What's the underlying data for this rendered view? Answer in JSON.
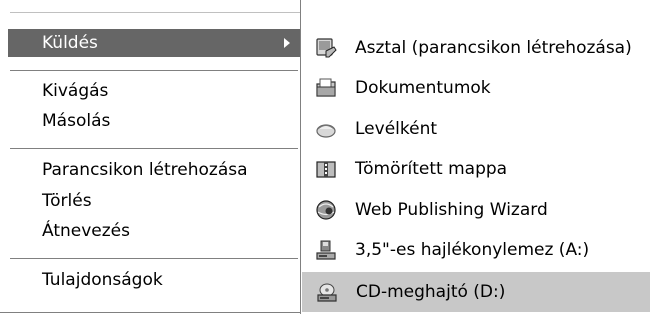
{
  "context_menu": {
    "items": [
      {
        "label": "Küldés",
        "highlighted": true,
        "has_submenu": true
      },
      {
        "label": "Kivágás"
      },
      {
        "label": "Másolás"
      },
      {
        "label": "Parancsikon létrehozása"
      },
      {
        "label": "Törlés"
      },
      {
        "label": "Átnevezés"
      },
      {
        "label": "Tulajdonságok"
      }
    ]
  },
  "send_to_submenu": {
    "items": [
      {
        "label": "Asztal (parancsikon létrehozása)",
        "icon": "desktop-icon"
      },
      {
        "label": "Dokumentumok",
        "icon": "documents-folder-icon"
      },
      {
        "label": "Levélként",
        "icon": "mail-icon"
      },
      {
        "label": "Tömörített mappa",
        "icon": "zip-folder-icon"
      },
      {
        "label": "Web Publishing Wizard",
        "icon": "web-publishing-icon"
      },
      {
        "label": "3,5\"-es hajlékonylemez (A:)",
        "icon": "floppy-drive-icon"
      },
      {
        "label": "CD-meghajtó (D:)",
        "icon": "cd-drive-icon",
        "hover": true
      }
    ]
  },
  "colors": {
    "highlight": "#666666",
    "hover": "#c8c8c8",
    "separator": "#808080"
  }
}
